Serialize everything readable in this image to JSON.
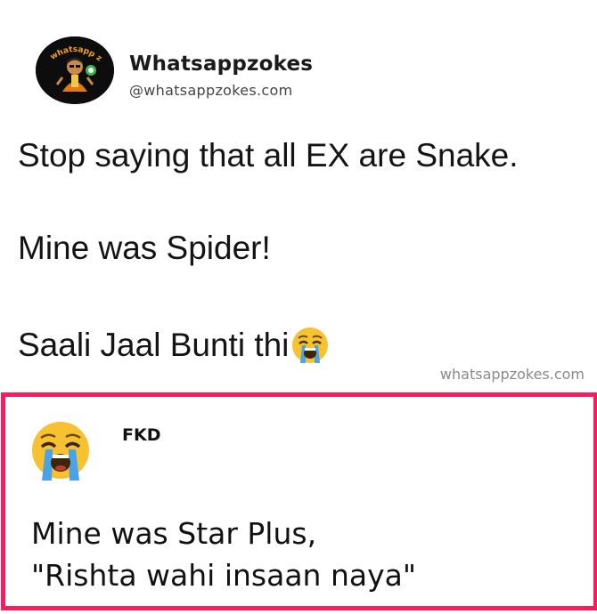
{
  "account": {
    "name": "Whatsappzokes",
    "handle": "@whatsappzokes.com",
    "avatar_text": "whatsapp zokes",
    "avatar_icon": "cartoon-face-logo"
  },
  "post": {
    "lines": [
      "Stop saying that all EX are Snake.",
      "Mine was Spider!",
      "Saali Jaal Bunti thi"
    ],
    "emoji": "crying-face-icon"
  },
  "watermark": "whatsappzokes.com",
  "reply": {
    "name": "FKD",
    "avatar_icon": "crying-face-icon",
    "lines": [
      "Mine was Star Plus,",
      "\"Rishta wahi insaan naya\""
    ],
    "border_color": "#ff1a5b"
  }
}
